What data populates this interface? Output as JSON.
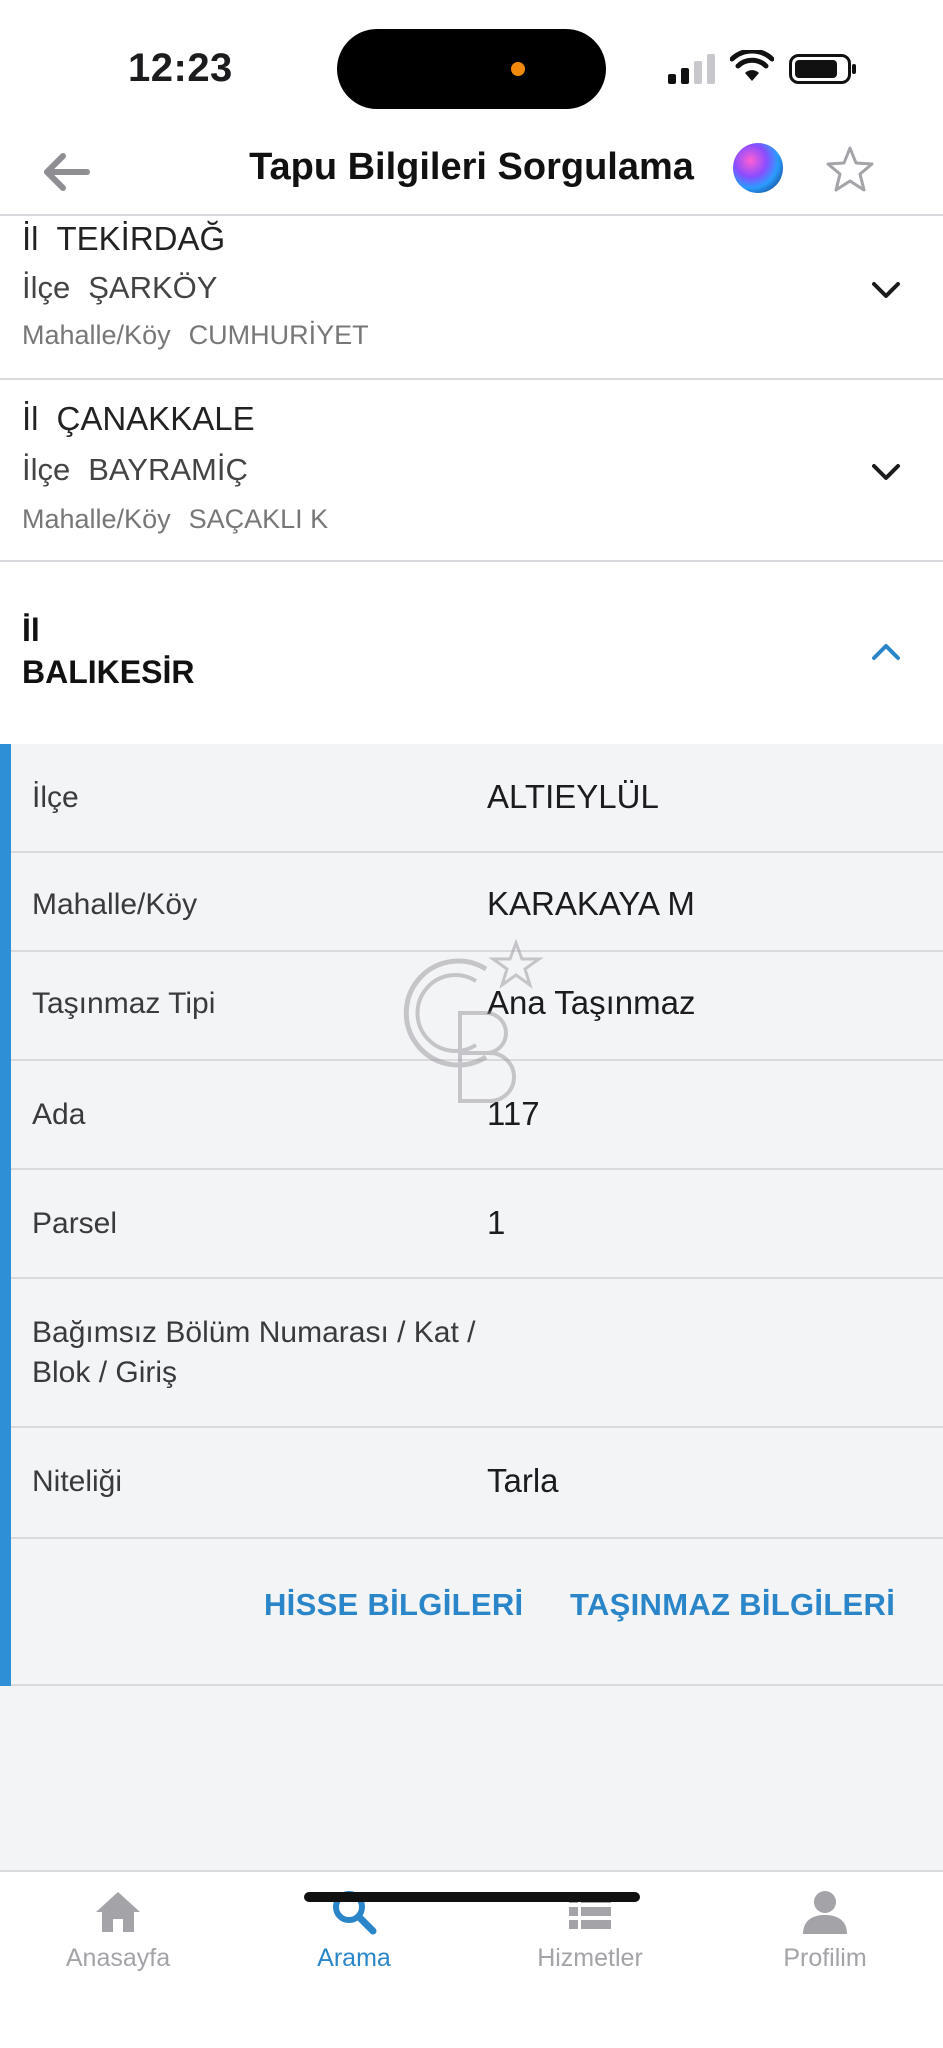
{
  "status_bar": {
    "time": "12:23"
  },
  "header": {
    "title": "Tapu Bilgileri Sorgulama"
  },
  "records": [
    {
      "il_label": "İl",
      "il": "TEKİRDAĞ",
      "ilce_label": "İlçe",
      "ilce": "ŞARKÖY",
      "mahalle_label": "Mahalle/Köy",
      "mahalle": "CUMHURİYET"
    },
    {
      "il_label": "İl",
      "il": "ÇANAKKALE",
      "ilce_label": "İlçe",
      "ilce": "BAYRAMİÇ",
      "mahalle_label": "Mahalle/Köy",
      "mahalle": "SAÇAKLI K"
    }
  ],
  "expanded": {
    "il_label": "İl",
    "il": "BALIKESİR",
    "details": [
      {
        "label": "İlçe",
        "value": "ALTIEYLÜL"
      },
      {
        "label": "Mahalle/Köy",
        "value": "KARAKAYA M"
      },
      {
        "label": "Taşınmaz Tipi",
        "value": "Ana Taşınmaz"
      },
      {
        "label": "Ada",
        "value": "117"
      },
      {
        "label": "Parsel",
        "value": "1"
      },
      {
        "label": "Bağımsız Bölüm Numarası / Kat / Blok / Giriş",
        "value": ""
      },
      {
        "label": "Niteliği",
        "value": "Tarla"
      }
    ],
    "actions": {
      "hisse": "HİSSE BİLGİLERİ",
      "tasinmaz": "TAŞINMAZ BİLGİLERİ"
    }
  },
  "tabs": [
    {
      "label": "Anasayfa",
      "icon": "home-icon",
      "active": false
    },
    {
      "label": "Arama",
      "icon": "search-icon",
      "active": true
    },
    {
      "label": "Hizmetler",
      "icon": "list-icon",
      "active": false
    },
    {
      "label": "Profilim",
      "icon": "profile-icon",
      "active": false
    }
  ],
  "colors": {
    "accent": "#2a86c8",
    "divider": "#d9d9de",
    "panel": "#f3f4f6"
  }
}
